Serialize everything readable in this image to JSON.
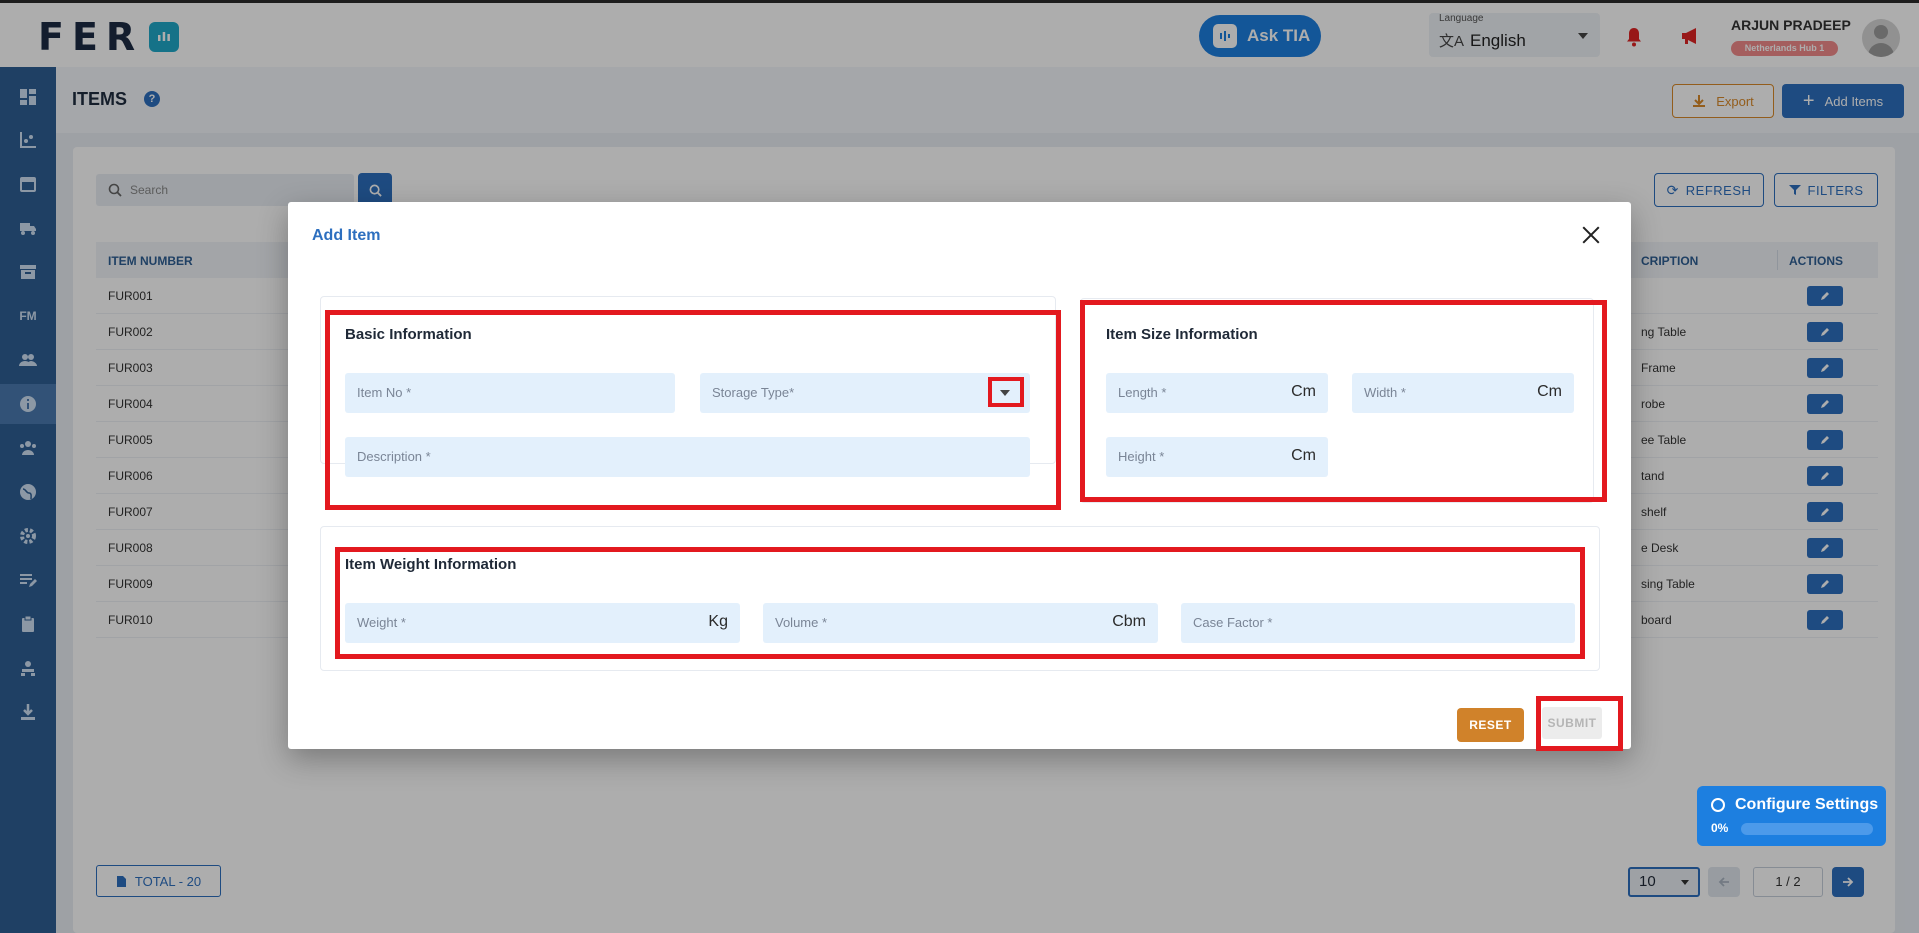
{
  "app": {
    "logo_text": "FER"
  },
  "topbar": {
    "ask_tia_label": "Ask TIA",
    "language_caption": "Language",
    "language_value": "English",
    "user_name": "ARJUN PRADEEP",
    "user_hub": "Netherlands Hub 1"
  },
  "sidebar": {
    "items": [
      {
        "name": "dashboard-icon"
      },
      {
        "name": "analytics-icon"
      },
      {
        "name": "calendar-icon"
      },
      {
        "name": "truck-icon"
      },
      {
        "name": "archive-icon"
      },
      {
        "name": "fm",
        "label": "FM"
      },
      {
        "name": "users-icon"
      },
      {
        "name": "info-icon",
        "active": true
      },
      {
        "name": "team-icon"
      },
      {
        "name": "globe-icon"
      },
      {
        "name": "settings-icon"
      },
      {
        "name": "edit-note-icon"
      },
      {
        "name": "clipboard-icon"
      },
      {
        "name": "org-icon"
      },
      {
        "name": "download-icon"
      }
    ]
  },
  "page": {
    "title": "ITEMS",
    "export_label": "Export",
    "add_label": "Add Items",
    "search_placeholder": "Search",
    "refresh_label": "REFRESH",
    "filters_label": "FILTERS"
  },
  "table": {
    "headers": {
      "item_number": "ITEM NUMBER",
      "description": "CRIPTION",
      "actions": "ACTIONS"
    },
    "rows": [
      {
        "num": "FUR001",
        "desc": ""
      },
      {
        "num": "FUR002",
        "desc": "ng Table"
      },
      {
        "num": "FUR003",
        "desc": "Frame"
      },
      {
        "num": "FUR004",
        "desc": "robe"
      },
      {
        "num": "FUR005",
        "desc": "ee Table"
      },
      {
        "num": "FUR006",
        "desc": "tand"
      },
      {
        "num": "FUR007",
        "desc": "shelf"
      },
      {
        "num": "FUR008",
        "desc": "e Desk"
      },
      {
        "num": "FUR009",
        "desc": "sing Table"
      },
      {
        "num": "FUR010",
        "desc": "board"
      }
    ]
  },
  "footer": {
    "total_label": "TOTAL  - 20",
    "page_size": "10",
    "page_indicator": "1 / 2"
  },
  "modal": {
    "title": "Add Item",
    "basic": {
      "title": "Basic Information",
      "item_no": "Item No *",
      "storage_type": "Storage Type*",
      "description": "Description *"
    },
    "size": {
      "title": "Item Size Information",
      "length": "Length *",
      "width": "Width *",
      "height": "Height *",
      "unit": "Cm"
    },
    "weight": {
      "title": "Item Weight Information",
      "weight": "Weight *",
      "weight_unit": "Kg",
      "volume": "Volume *",
      "volume_unit": "Cbm",
      "case_factor": "Case Factor *"
    },
    "reset_label": "RESET",
    "submit_label": "SUBMIT"
  },
  "configure": {
    "title": "Configure Settings",
    "progress_label": "0%",
    "progress": 0
  },
  "colors": {
    "primary": "#2d6fbf",
    "highlight": "#e3191f",
    "reset": "#d0822a",
    "tia": "#1d7fe0"
  }
}
